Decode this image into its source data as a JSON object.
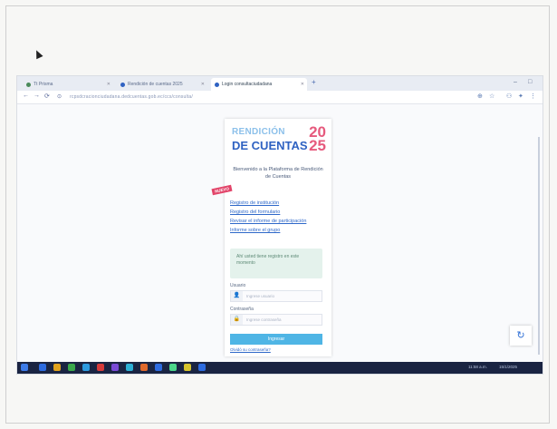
{
  "browser": {
    "tabs": [
      {
        "label": "Tt Prisma",
        "active": false
      },
      {
        "label": "Rendición de cuentas 2025",
        "active": false
      },
      {
        "label": "Login consultaciudadana",
        "active": true
      }
    ],
    "new_tab_label": "+",
    "url": "rcpsdcracionciudadana.dedcuentas.gob.ec/ccs/consulta/",
    "window_controls": [
      "⌄",
      "–",
      "□",
      "✕"
    ]
  },
  "login": {
    "logo_top": "RENDICIÓN",
    "logo_bottom": "DE CUENTAS",
    "logo_year": "20\n25",
    "welcome": "Bienvenido a la Plataforma de Rendición de Cuentas",
    "badge": "NUEVO",
    "links": [
      "Registro de institución",
      "Registro del formulario",
      "Revisar el informe de participación",
      "Informe sobre el grupo"
    ],
    "notice": "Ahí usted tiene registro en este momento",
    "user_label": "Usuario",
    "user_placeholder": "Ingrese usuario",
    "password_label": "Contraseña",
    "password_placeholder": "Ingrese contraseña",
    "submit_label": "Ingresar",
    "forgot_label": "Olvidó su contraseña?"
  },
  "taskbar": {
    "clock": "11:58 a.m.",
    "date": "15/1/2025",
    "app_colors": [
      "#2d6be0",
      "#e0a21d",
      "#3aa84b",
      "#2d9be0",
      "#d63b3b",
      "#7a4bd6",
      "#2db0d6",
      "#e06a2d",
      "#2d6be0",
      "#4bd68a",
      "#d6c32d",
      "#2d6be0"
    ]
  },
  "colors": {
    "accent": "#2f62c2",
    "logo_light": "#8cc0ea",
    "logo_pink": "#e65a7d",
    "button": "#4fb5e5",
    "taskbar": "#1a2442"
  }
}
